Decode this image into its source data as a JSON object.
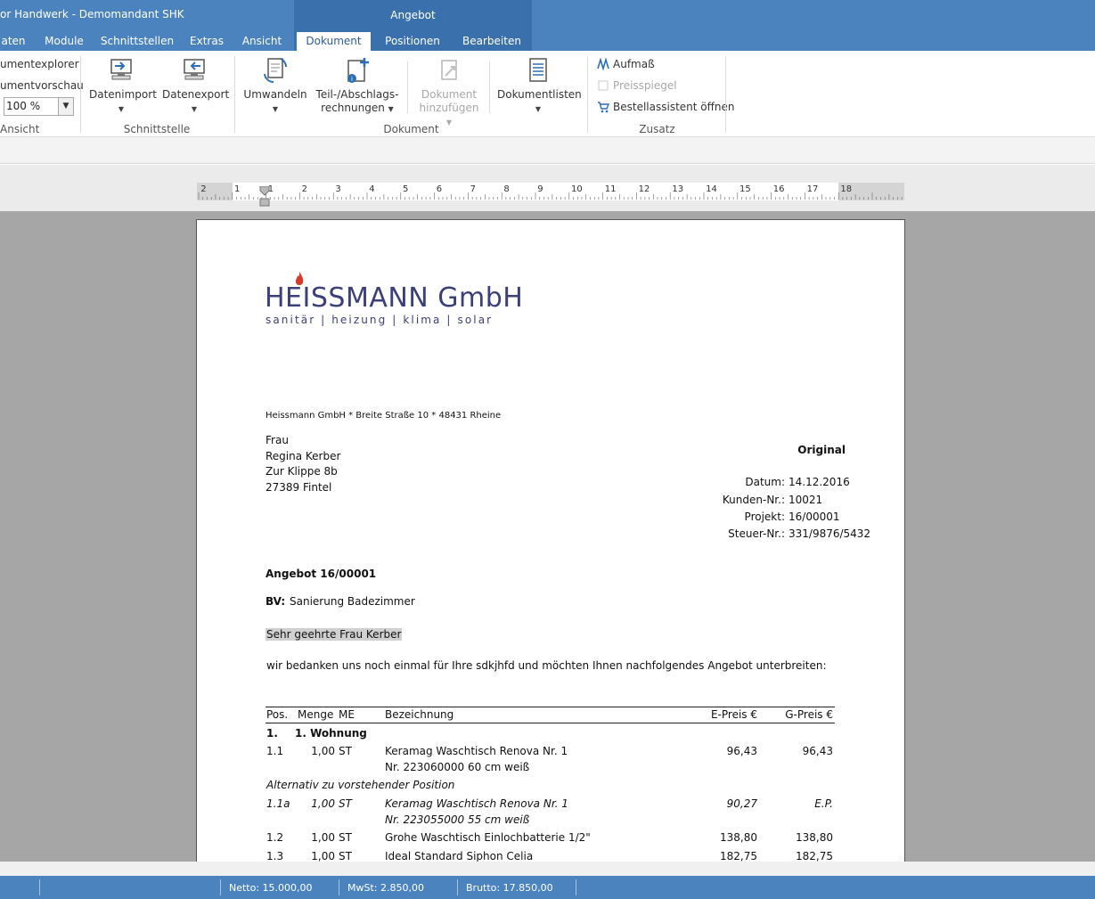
{
  "window": {
    "title": "or Handwerk -  Demomandant SHK",
    "context_tab_group": "Angebot"
  },
  "tabs": [
    "aten",
    "Module",
    "Schnittstellen",
    "Extras",
    "Ansicht",
    "Dokument",
    "Positionen",
    "Bearbeiten"
  ],
  "ribbon": {
    "ansicht": {
      "explorer_label": "umentexplorer",
      "preview_label": "umentvorschau",
      "zoom_value": "100 %",
      "group_label": "Ansicht"
    },
    "schnittstelle": {
      "import_label": "Datenimport",
      "export_label": "Datenexport",
      "group_label": "Schnittstelle"
    },
    "dokument": {
      "convert_label": "Umwandeln",
      "partial_line1": "Teil-/Abschlags-",
      "partial_line2": "rechnungen",
      "add_line1": "Dokument",
      "add_line2": "hinzufügen",
      "lists_label": "Dokumentlisten",
      "group_label": "Dokument"
    },
    "zusatz": {
      "aufmass_label": "Aufmaß",
      "preisspiegel_label": "Preisspiegel",
      "bestell_label": "Bestellassistent öffnen",
      "group_label": "Zusatz"
    }
  },
  "ruler_numbers": [
    "2",
    "1",
    "1",
    "2",
    "3",
    "4",
    "5",
    "6",
    "7",
    "8",
    "9",
    "10",
    "11",
    "12",
    "13",
    "14",
    "15",
    "16",
    "17",
    "18"
  ],
  "document": {
    "logo_name": "HEISSMANN GmbH",
    "logo_tagline": "sanitär | heizung | klima | solar",
    "sender_line": "Heissmann GmbH * Breite Straße 10 * 48431 Rheine",
    "recipient": [
      "Frau",
      "Regina Kerber",
      "Zur Klippe 8b",
      "27389 Fintel"
    ],
    "original_label": "Original",
    "meta": [
      {
        "label": "Datum:",
        "value": "14.12.2016"
      },
      {
        "label": "Kunden-Nr.:",
        "value": "10021"
      },
      {
        "label": "Projekt:",
        "value": "16/00001"
      },
      {
        "label": "Steuer-Nr.:",
        "value": "331/9876/5432"
      }
    ],
    "subject": "Angebot 16/00001",
    "bv_label": "BV:",
    "bv_value": "Sanierung Badezimmer",
    "salutation": "Sehr geehrte Frau Kerber",
    "intro": "wir bedanken uns noch einmal für Ihre sdkjhfd und möchten Ihnen nachfolgendes Angebot unterbreiten:",
    "table_headers": {
      "pos": "Pos.",
      "menge": "Menge",
      "me": "ME",
      "bezeichnung": "Bezeichnung",
      "epreis": "E-Preis €",
      "gpreis": "G-Preis €"
    },
    "section": {
      "pos": "1.",
      "title": "1. Wohnung"
    },
    "rows": [
      {
        "pos": "1.1",
        "menge": "1,00",
        "me": "ST",
        "desc1": "Keramag Waschtisch Renova Nr. 1",
        "desc2": "Nr. 223060000 60 cm weiß",
        "epreis": "96,43",
        "gpreis": "96,43"
      },
      {
        "pos": "1.1a",
        "menge": "1,00",
        "me": "ST",
        "desc1": "Keramag Waschtisch Renova Nr. 1",
        "desc2": "Nr. 223055000 55 cm weiß",
        "epreis": "90,27",
        "gpreis": "E.P."
      },
      {
        "pos": "1.2",
        "menge": "1,00",
        "me": "ST",
        "desc1": "Grohe Waschtisch Einlochbatterie 1/2\"",
        "desc2": "",
        "epreis": "138,80",
        "gpreis": "138,80"
      },
      {
        "pos": "1.3",
        "menge": "1,00",
        "me": "ST",
        "desc1": "Ideal Standard Siphon Celia",
        "desc2": "",
        "epreis": "182,75",
        "gpreis": "182,75"
      }
    ],
    "alternative_note": "Alternativ zu vorstehender Position"
  },
  "status": {
    "netto": "Netto: 15.000,00",
    "mwst": "MwSt: 2.850,00",
    "brutto": "Brutto: 17.850,00"
  }
}
